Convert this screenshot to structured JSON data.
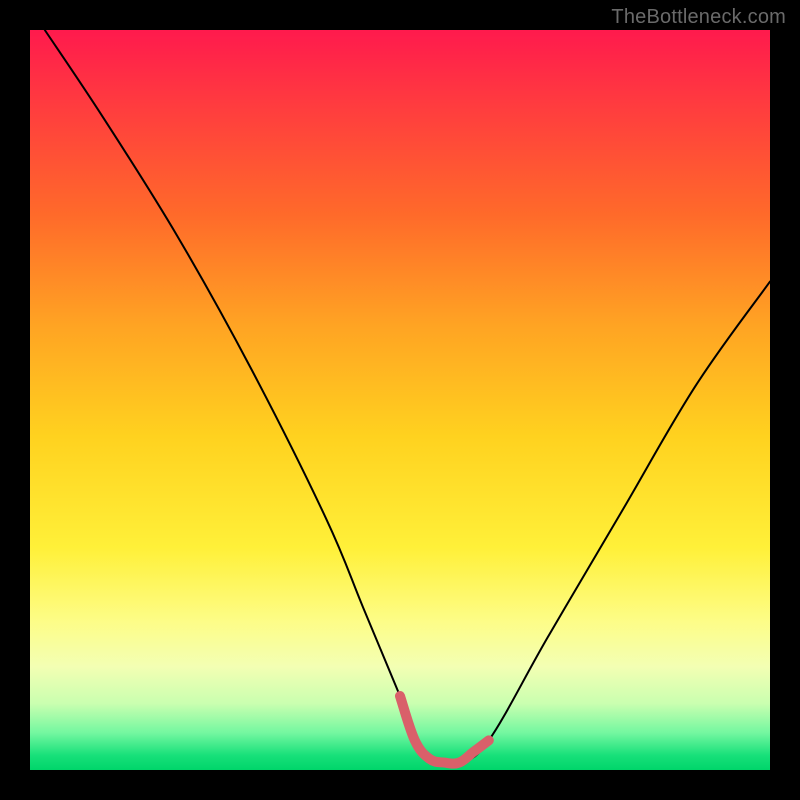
{
  "watermark": "TheBottleneck.com",
  "chart_data": {
    "type": "line",
    "title": "",
    "xlabel": "",
    "ylabel": "",
    "xlim": [
      0,
      100
    ],
    "ylim": [
      0,
      100
    ],
    "grid": false,
    "legend": false,
    "series": [
      {
        "name": "bottleneck-curve",
        "x": [
          2,
          10,
          20,
          30,
          40,
          45,
          50,
          53,
          55,
          58,
          62,
          70,
          80,
          90,
          100
        ],
        "y": [
          100,
          88,
          72,
          54,
          34,
          22,
          10,
          3,
          1,
          1,
          4,
          18,
          35,
          52,
          66
        ],
        "color": "#000000",
        "stroke_width": 2
      },
      {
        "name": "highlight-segment",
        "x": [
          50,
          52,
          54,
          56,
          58,
          60,
          62
        ],
        "y": [
          10,
          4,
          1.5,
          1,
          1,
          2.5,
          4
        ],
        "color": "#d9606a",
        "stroke_width": 10
      }
    ],
    "background_gradient": {
      "top": "#ff1a4d",
      "mid": "#ffd21f",
      "bottom": "#00d56a"
    }
  }
}
